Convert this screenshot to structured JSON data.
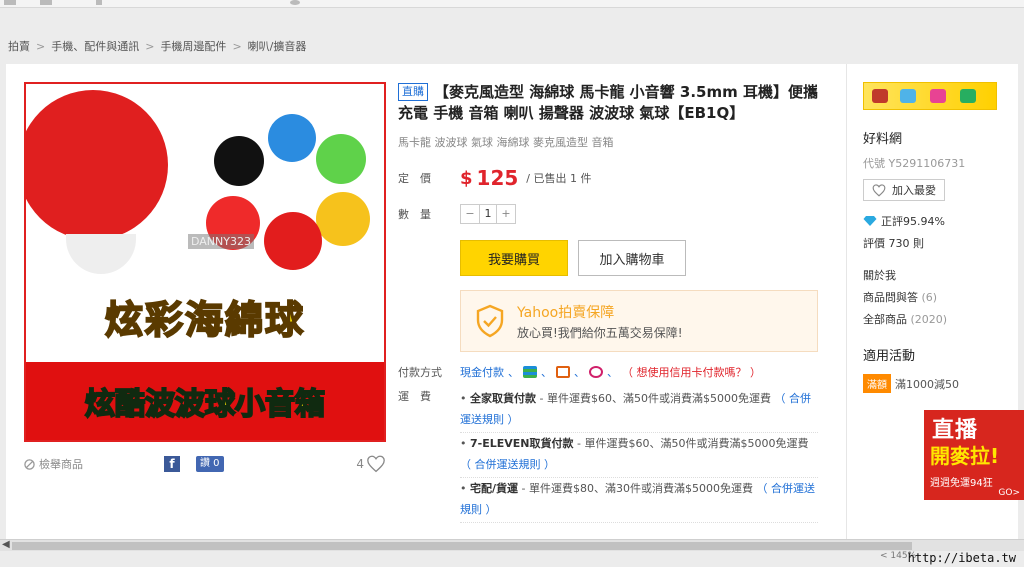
{
  "breadcrumb": {
    "items": [
      "拍賣",
      "手機、配件與通訊",
      "手機周邊配件",
      "喇叭/擴音器"
    ],
    "sep": ">"
  },
  "product": {
    "direct_tag": "直購",
    "title": "【麥克風造型 海綿球 馬卡龍 小音響 3.5mm 耳機】便攜 充電 手機 音箱 喇叭 揚聲器 波波球 氣球【EB1Q】",
    "subtitle": "馬卡龍 波波球 氣球 海綿球 麥克風造型 音箱",
    "price_label": "定　價",
    "price_currency": "$",
    "price": "125",
    "sold": "/ 已售出 1 件",
    "qty_label": "數　量",
    "qty_minus": "−",
    "qty_value": "1",
    "qty_plus": "+",
    "buy_button": "我要購買",
    "cart_button": "加入購物車"
  },
  "image": {
    "watermark": "DANNY323",
    "banner_top": "炫彩海綿球",
    "banner_bottom": "炫酷波波球小音箱"
  },
  "below_image": {
    "report": "檢舉商品",
    "fb": "f",
    "like": "讚 0",
    "fav_count": "4"
  },
  "protection": {
    "title": "Yahoo拍賣保障",
    "desc": "放心買!我們給你五萬交易保障!"
  },
  "payment": {
    "label": "付款方式",
    "cash": "現金付款",
    "sep": "、",
    "credit_question": "（ 想使用信用卡付款嗎？ ）"
  },
  "shipping": {
    "label": "運　費",
    "items": [
      {
        "name": "全家取貨付款",
        "desc": " - 單件運費$60、滿50件或消費滿$5000免運費",
        "link": "（ 合併運送規則 ）"
      },
      {
        "name": "7-ELEVEN取貨付款",
        "desc": " - 單件運費$60、滿50件或消費滿$5000免運費",
        "link": "（ 合併運送規則 ）"
      },
      {
        "name": "宅配/貨運",
        "desc": " - 單件運費$80、滿30件或消費滿$5000免運費",
        "link": "（ 合併運送規則 ）"
      }
    ]
  },
  "seller": {
    "name": "好料網",
    "code": "代號 Y5291106731",
    "fav_button": "加入最愛",
    "rating": "正評95.94%",
    "rating_count": "評價 730 則",
    "about": "關於我",
    "qa": "商品問與答",
    "qa_count": "(6)",
    "all": "全部商品",
    "all_count": "(2020)",
    "activity_title": "適用活動",
    "activity_badge": "滿額",
    "activity_text": "滿1000減50"
  },
  "float_ad": {
    "line1": "直播",
    "line2": "開麥拉!",
    "line3": "週週免運94狂",
    "go": "GO>"
  },
  "footer": {
    "site": "http://ibeta.tw",
    "zoom": "< 145%"
  },
  "colors": {
    "price": "#e0242c",
    "link": "#1f6fd6",
    "buy": "#ffd400",
    "protect_bg": "#fff7ec"
  }
}
